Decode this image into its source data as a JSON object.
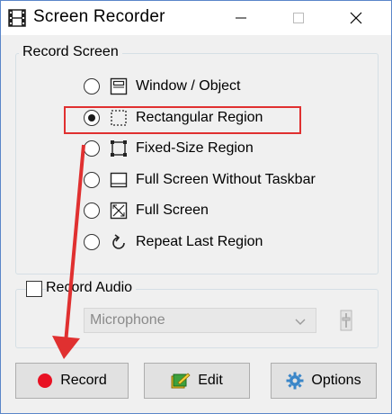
{
  "window": {
    "title": "Screen Recorder"
  },
  "record_screen": {
    "group_label": "Record Screen",
    "options": [
      {
        "label": "Window / Object",
        "icon": "window-icon",
        "selected": false
      },
      {
        "label": "Rectangular Region",
        "icon": "rectangular-region-icon",
        "selected": true
      },
      {
        "label": "Fixed-Size Region",
        "icon": "fixed-size-region-icon",
        "selected": false
      },
      {
        "label": "Full Screen Without Taskbar",
        "icon": "full-screen-without-taskbar-icon",
        "selected": false
      },
      {
        "label": "Full Screen",
        "icon": "full-screen-icon",
        "selected": false
      },
      {
        "label": "Repeat Last Region",
        "icon": "repeat-icon",
        "selected": false
      }
    ]
  },
  "record_audio": {
    "label": "Record Audio",
    "checked": false,
    "device": "Microphone",
    "enabled": false
  },
  "buttons": {
    "record": "Record",
    "edit": "Edit",
    "options": "Options"
  },
  "colors": {
    "annotation_red": "#e03030",
    "record_dot": "#e81123",
    "border_blue": "#5a86c9"
  }
}
